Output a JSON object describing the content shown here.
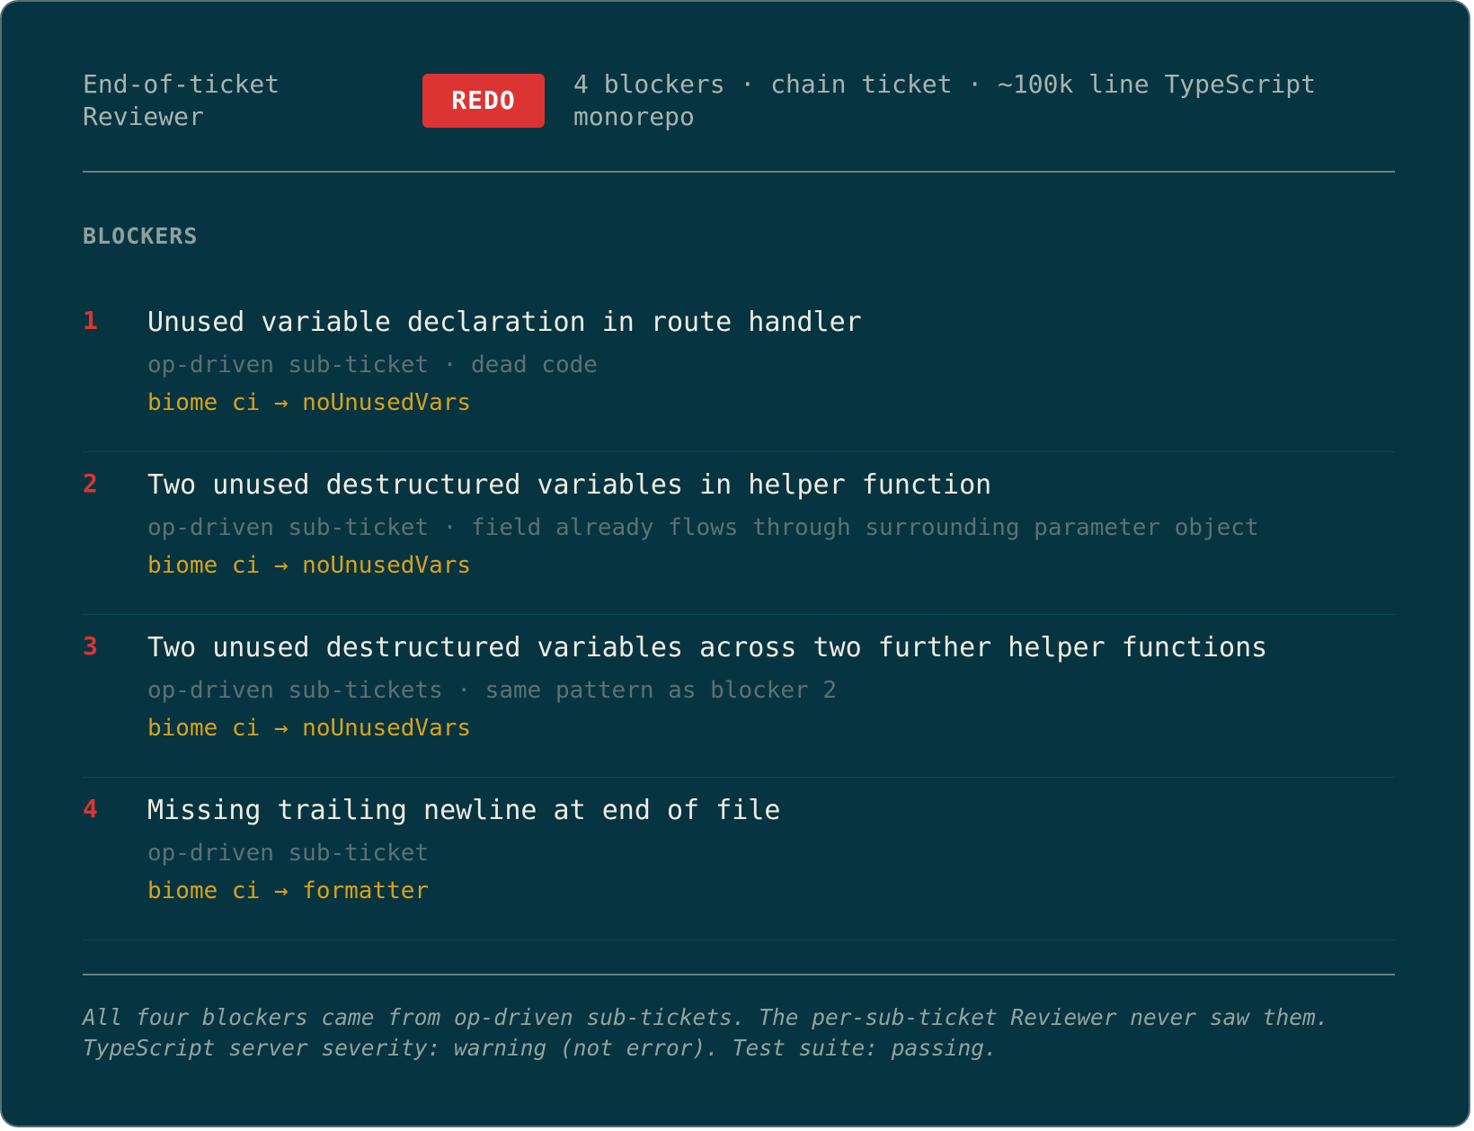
{
  "header": {
    "title": "End-of-ticket Reviewer",
    "status": "REDO",
    "summary": "4 blockers · chain ticket · ~100k line TypeScript monorepo"
  },
  "section_label": "BLOCKERS",
  "blockers": [
    {
      "number": "1",
      "title": "Unused variable declaration in route handler",
      "meta": "op-driven sub-ticket · dead code",
      "rule": "biome ci → noUnusedVars"
    },
    {
      "number": "2",
      "title": "Two unused destructured variables in helper function",
      "meta": "op-driven sub-ticket · field already flows through surrounding parameter object",
      "rule": "biome ci → noUnusedVars"
    },
    {
      "number": "3",
      "title": "Two unused destructured variables across two further helper functions",
      "meta": "op-driven sub-tickets · same pattern as blocker 2",
      "rule": "biome ci → noUnusedVars"
    },
    {
      "number": "4",
      "title": "Missing trailing newline at end of file",
      "meta": "op-driven sub-ticket",
      "rule": "biome ci → formatter"
    }
  ],
  "footer": {
    "note": "All four blockers came from op-driven sub-tickets. The per-sub-ticket Reviewer never saw them. TypeScript server severity: warning (not error). Test suite: passing."
  },
  "colors": {
    "background": "#073441",
    "status_red": "#dc3432",
    "rule_amber": "#d8a21c"
  }
}
